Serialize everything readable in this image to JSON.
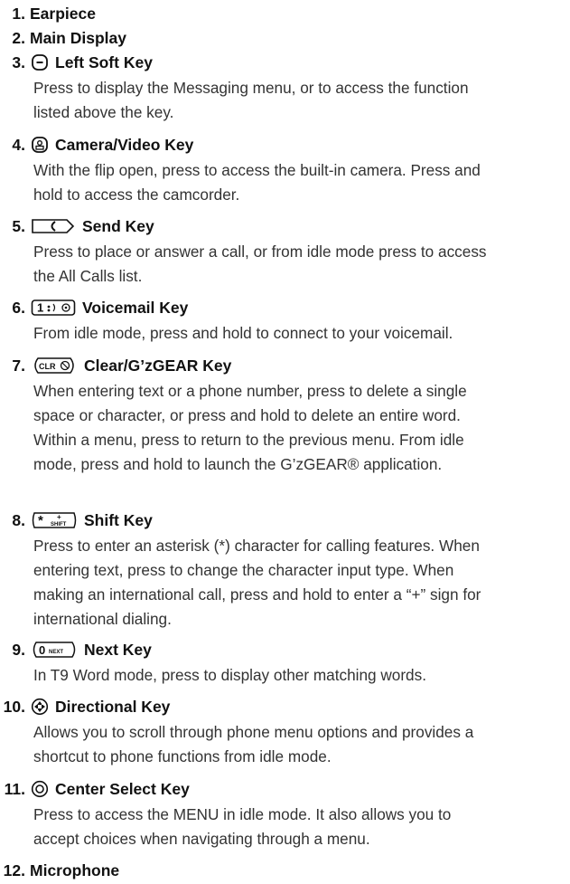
{
  "items": [
    {
      "num": "1.",
      "title": "Earpiece",
      "icon": null,
      "lines": []
    },
    {
      "num": "2.",
      "title": "Main Display",
      "icon": null,
      "lines": []
    },
    {
      "num": "3.",
      "title": "Left Soft Key",
      "icon": "minus-key-icon",
      "lines": [
        "Press to display the Messaging menu, or to access the function",
        "listed above the key."
      ]
    },
    {
      "num": "4.",
      "title": "Camera/Video Key",
      "icon": "camera-key-icon",
      "lines": [
        "With the flip open, press to access the built-in camera. Press and",
        "hold to access the camcorder."
      ]
    },
    {
      "num": "5.",
      "title": "Send Key",
      "icon": "send-key-icon",
      "lines": [
        "Press to place or answer a call, or from idle mode press to access",
        "the All Calls list."
      ]
    },
    {
      "num": "6.",
      "title": "Voicemail Key",
      "icon": "voicemail-key-icon",
      "lines": [
        "From idle mode, press and hold to connect to your voicemail."
      ]
    },
    {
      "num": "7.",
      "title": "Clear/G’zGEAR Key",
      "icon": "clear-key-icon",
      "lines": [
        "When entering text or a phone number, press to delete a single",
        "space or character, or press and hold to delete an entire word.",
        "Within a menu, press to return to the previous menu. From idle",
        "mode, press and hold to launch the G’zGEAR® application."
      ]
    },
    {
      "num": "8.",
      "title": "Shift Key",
      "icon": "shift-key-icon",
      "lines": [
        "Press to enter an asterisk (*) character for calling features. When",
        "entering text, press to change the character input type. When",
        "making an international call, press and hold to enter a “+” sign for",
        "international dialing."
      ]
    },
    {
      "num": "9.",
      "title": "Next Key",
      "icon": "next-key-icon",
      "lines": [
        "In T9 Word mode, press to display other matching words."
      ]
    },
    {
      "num": "10.",
      "title": "Directional Key",
      "icon": "directional-key-icon",
      "lines": [
        "Allows you to scroll through phone menu options and provides a",
        "shortcut to phone functions from idle mode."
      ]
    },
    {
      "num": "11.",
      "title": "Center Select Key",
      "icon": "center-select-key-icon",
      "lines": [
        "Press to access the MENU in idle mode. It also allows you to",
        "accept choices when navigating through a menu."
      ]
    },
    {
      "num": "12.",
      "title": "Microphone",
      "icon": null,
      "lines": []
    }
  ],
  "icon_glyphs": {
    "voicemail_key": "1",
    "clear_key": "CLR",
    "shift_key_sub": "SHIFT",
    "next_key": "0",
    "next_key_sub": "NEXT"
  }
}
